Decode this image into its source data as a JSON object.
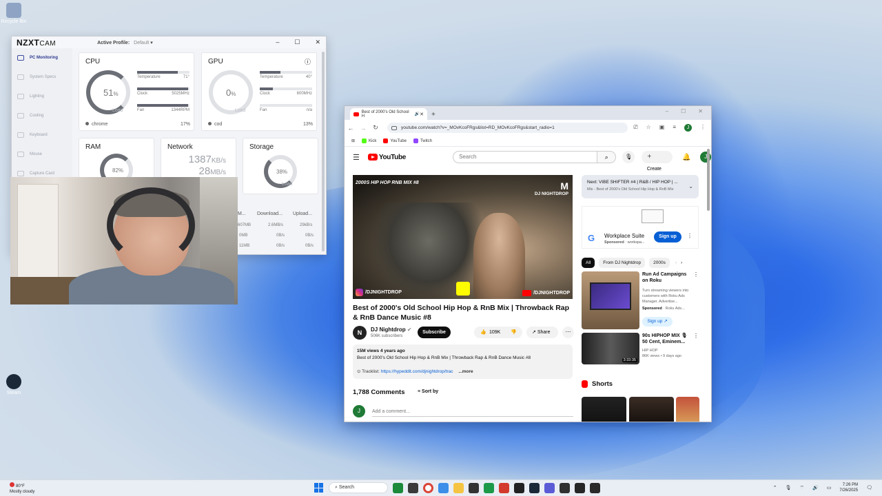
{
  "desktop": {
    "icons": [
      {
        "label": "Recycle Bin",
        "color": "#8fa4c4"
      },
      {
        "label": "Steam",
        "color": "#1b2838"
      }
    ]
  },
  "nzxt": {
    "logo": "NZXT",
    "logo_sub": "CAM",
    "profile_label": "Active Profile:",
    "profile_value": "Default",
    "window_controls": [
      "–",
      "☐",
      "✕"
    ],
    "sidebar": [
      {
        "label": "PC Monitoring",
        "active": true
      },
      {
        "label": "System Specs",
        "active": false
      },
      {
        "label": "Lighting",
        "active": false
      },
      {
        "label": "Cooling",
        "active": false
      },
      {
        "label": "Keyboard",
        "active": false
      },
      {
        "label": "Mouse",
        "active": false
      },
      {
        "label": "Capture Card",
        "active": false
      }
    ],
    "cpu": {
      "title": "CPU",
      "load": "51",
      "unit": "%",
      "load_label": "Load",
      "temp_label": "Temperature",
      "temp": "71°",
      "temp_level": 0.78,
      "clock_label": "Clock",
      "clock": "5025MHz",
      "clock_level": 0.97,
      "fan_label": "Fan",
      "fan": "1344RPM",
      "fan_level": 0.98,
      "process": "chrome",
      "process_pct": "17%"
    },
    "gpu": {
      "title": "GPU",
      "load": "0",
      "unit": "%",
      "load_label": "Load",
      "temp_label": "Temperature",
      "temp": "40°",
      "temp_level": 0.4,
      "clock_label": "Clock",
      "clock": "600MHz",
      "clock_level": 0.25,
      "fan_label": "Fan",
      "fan": "n/a",
      "fan_level": 0.0,
      "process": "cod",
      "process_pct": "13%"
    },
    "ram": {
      "title": "RAM",
      "load": "82%"
    },
    "network": {
      "title": "Network",
      "down": "1387",
      "down_unit": "KB/s",
      "up": "28",
      "up_unit": "MB/s"
    },
    "storage": {
      "title": "Storage",
      "load": "38%",
      "load_label": "Load"
    },
    "table": {
      "headers": [
        "M...",
        "Download...",
        "Upload..."
      ],
      "rows": [
        [
          "607MB",
          "2.6MB/s",
          "29kB/s"
        ],
        [
          "0MB",
          "0B/s",
          "0B/s"
        ],
        [
          "11MB",
          "0B/s",
          "0B/s"
        ]
      ]
    }
  },
  "chrome": {
    "tab_title": "Best of 2000's Old School H",
    "new_tab": "+",
    "window_controls": [
      "–",
      "☐",
      "✕"
    ],
    "nav": [
      "←",
      "→",
      "↻"
    ],
    "url": "youtube.com/watch?v=_MOvKcoFRgs&list=RD_MOvKcoFRgs&start_radio=1",
    "profile_initial": "J",
    "bookmarks": [
      {
        "label": "Kick",
        "color": "#53fc18"
      },
      {
        "label": "YouTube",
        "color": "#ff0000"
      },
      {
        "label": "Twitch",
        "color": "#9146ff"
      }
    ]
  },
  "youtube": {
    "logo": "YouTube",
    "search_placeholder": "Search",
    "create": "Create",
    "avatar": "J",
    "player": {
      "caption": "2000S HIP HOP RNB MIX #8",
      "brand": "DJ NIGHTDROP",
      "tag_left": "/DJNIGHTDROP",
      "tag_right": "/DJNIGHTDROP"
    },
    "video_title": "Best of 2000's Old School Hip Hop & RnB Mix | Throwback Rap & RnB Dance Music #8",
    "channel": "DJ Nightdrop",
    "channel_initial": "N",
    "subscribers": "506K subscribers",
    "subscribe": "Subscribe",
    "likes": "109K",
    "share": "Share",
    "more": "⋯",
    "description": {
      "stats": "15M views  4 years ago",
      "text": "Best of 2000's Old School Hip Hop & RnB Mix | Throwback Rap & RnB Dance Music #8",
      "tracklist_label": "Tracklist:",
      "tracklist_link": "https://hypeddit.com/djnightdrop/trac",
      "more": "...more"
    },
    "comments_count": "1,788 Comments",
    "sort_by": "Sort by",
    "add_comment": "Add a comment...",
    "next": {
      "label": "Next: VIBE SHIFTER #4 | R&B / HIP HOP | ...",
      "sub": "Mix - Best of 2000's Old School Hip Hop & RnB Mix"
    },
    "ad": {
      "title": "Workplace Suite",
      "sponsored": "Sponsored",
      "domain": "workspa...",
      "cta": "Sign up"
    },
    "chips": [
      "All",
      "From DJ Nightdrop",
      "2000s"
    ],
    "recommendations": [
      {
        "title": "Run Ad Campaigns on Roku",
        "desc": "Turn streaming viewers into customers with Roku Ads Manager. Advertise...",
        "sponsored": "Sponsored",
        "source": "Roku Ads...",
        "cta": "Sign up"
      },
      {
        "title": "90s HIPHOP MIX 🎙 50 Cent, Eminem...",
        "channel": "HIP HOP",
        "meta": "86K views • 9 days ago",
        "duration": "3:33:35"
      }
    ],
    "shorts": "Shorts"
  },
  "taskbar": {
    "temperature": "80°F",
    "weather": "Mostly cloudy",
    "search": "Search",
    "time": "7:26 PM",
    "date": "7/26/2025",
    "apps": [
      "#1b8a3a",
      "#3a3a3a",
      "#ffffff",
      "#3c8ee8",
      "#f5c443",
      "#333333",
      "#1c9a49",
      "#d33a2b",
      "#222222",
      "#1b2838",
      "#5b5bd6",
      "#303030",
      "#262626",
      "#2a2a2a"
    ]
  }
}
